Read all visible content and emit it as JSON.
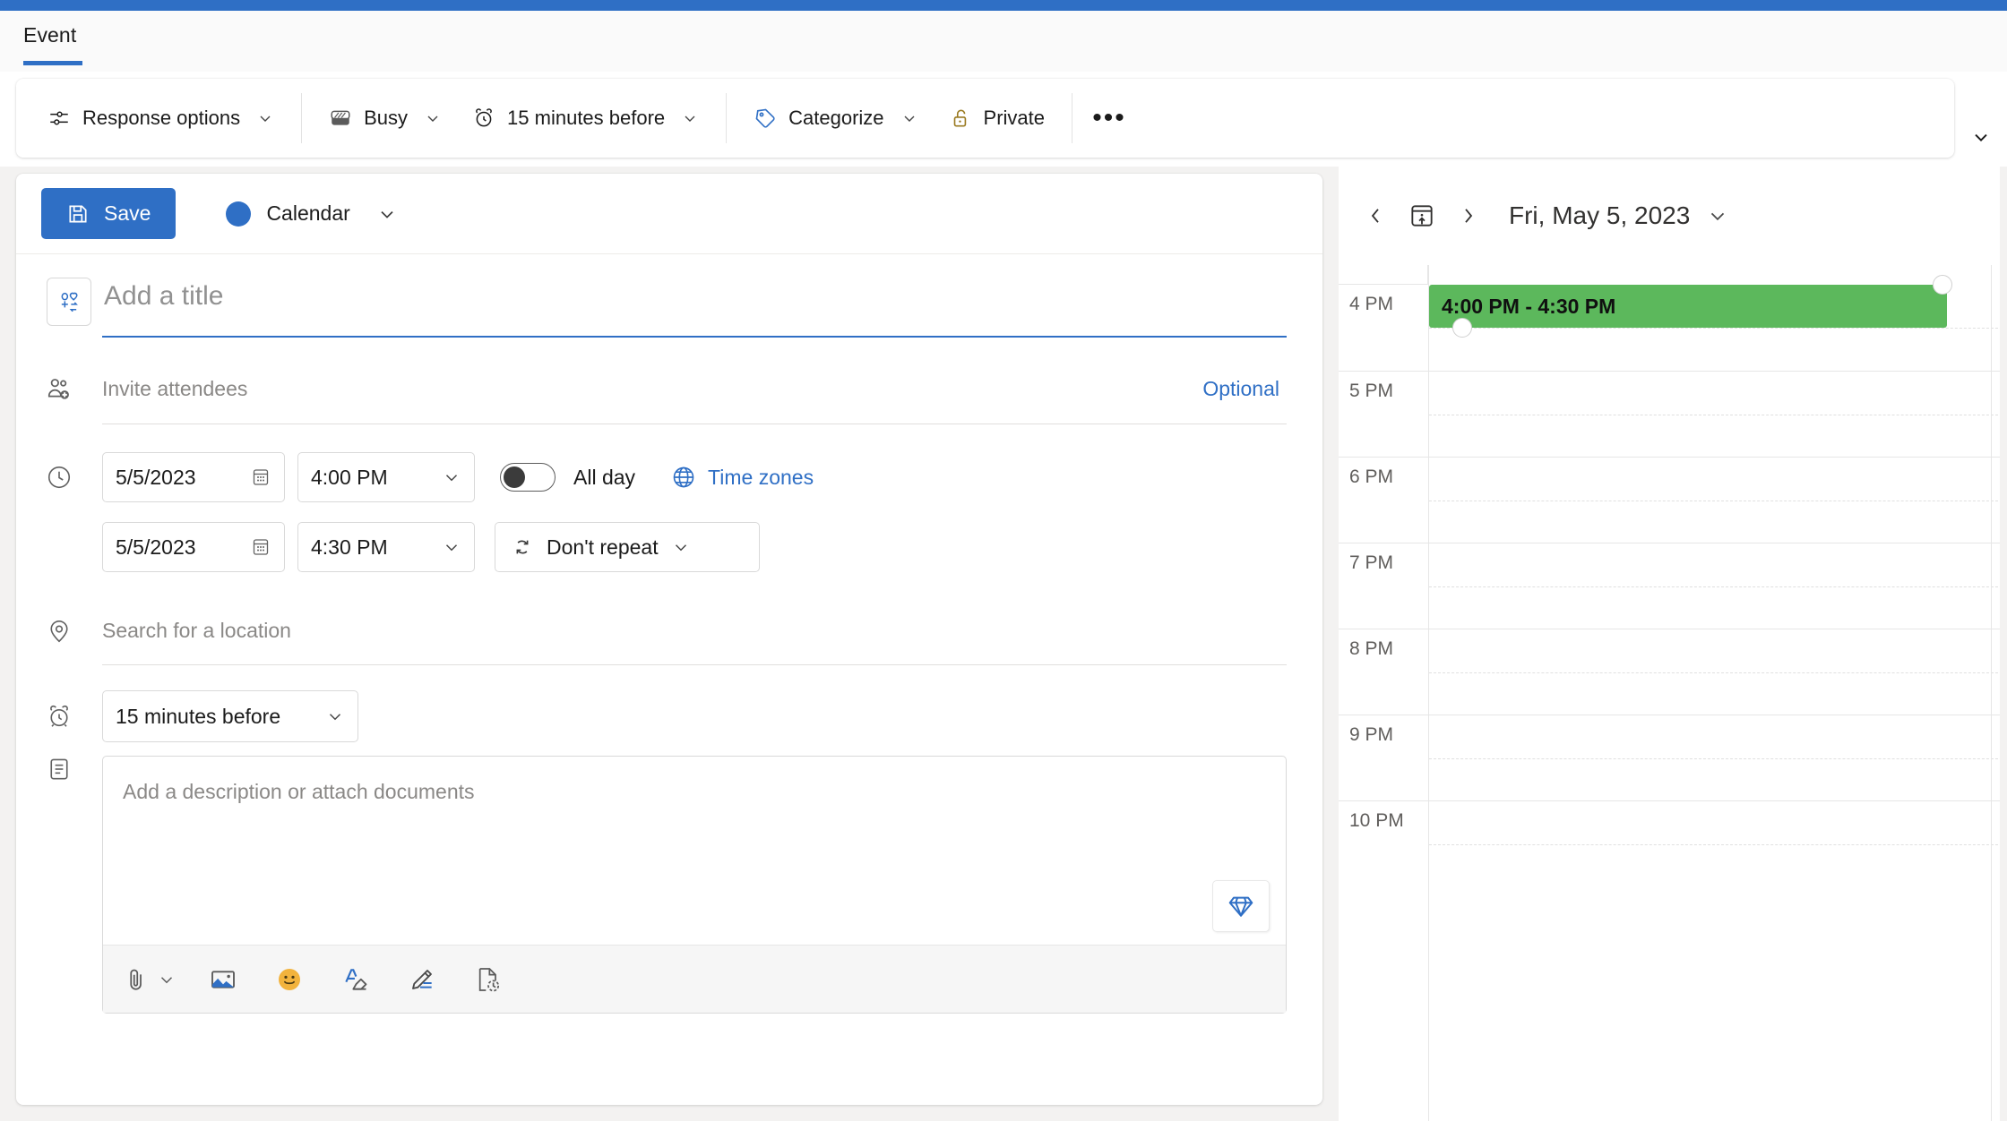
{
  "app": {
    "tab_label": "Event",
    "accent_color": "#2f6fc5",
    "event_color": "#5cb85c"
  },
  "ribbon": {
    "items": [
      {
        "id": "response-options",
        "label": "Response options",
        "icon": "response-options-icon",
        "has_chevron": true
      },
      {
        "id": "busy",
        "label": "Busy",
        "icon": "busy-icon",
        "has_chevron": true
      },
      {
        "id": "reminder",
        "label": "15 minutes before",
        "icon": "alarm-clock-icon",
        "has_chevron": true
      },
      {
        "id": "categorize",
        "label": "Categorize",
        "icon": "tag-icon",
        "has_chevron": true
      },
      {
        "id": "private",
        "label": "Private",
        "icon": "lock-icon",
        "has_chevron": false
      }
    ],
    "overflow_label": "•••",
    "expand_label": "⌄"
  },
  "form": {
    "save_label": "Save",
    "calendar_label": "Calendar",
    "calendar_dot_color": "#2f6fc5",
    "title": {
      "value": "",
      "placeholder": "Add a title"
    },
    "attendees": {
      "value": "",
      "placeholder": "Invite attendees"
    },
    "optional_label": "Optional",
    "start": {
      "date": "5/5/2023",
      "time": "4:00 PM"
    },
    "end": {
      "date": "5/5/2023",
      "time": "4:30 PM"
    },
    "all_day_label": "All day",
    "all_day_on": false,
    "time_zones_label": "Time zones",
    "repeat_label": "Don't repeat",
    "location": {
      "value": "",
      "placeholder": "Search for a location"
    },
    "reminder_label": "15 minutes before",
    "description": {
      "value": "",
      "placeholder": "Add a description or attach documents"
    },
    "editor_toolbar": [
      {
        "id": "attach",
        "icon": "paperclip-icon",
        "has_chevron": true
      },
      {
        "id": "insert-picture",
        "icon": "image-icon",
        "has_chevron": false
      },
      {
        "id": "emoji",
        "icon": "smiley-icon",
        "has_chevron": false
      },
      {
        "id": "clear-formatting",
        "icon": "clear-formatting-icon",
        "has_chevron": false
      },
      {
        "id": "draw",
        "icon": "pen-icon",
        "has_chevron": false
      },
      {
        "id": "insert-file",
        "icon": "document-clock-icon",
        "has_chevron": false
      }
    ],
    "loop_icon": "diamond-icon"
  },
  "calendar_panel": {
    "prev_label": "‹",
    "today_icon": "today-icon",
    "next_label": "›",
    "date_label": "Fri, May 5, 2023",
    "hours": [
      "4 PM",
      "5 PM",
      "6 PM",
      "7 PM",
      "8 PM",
      "9 PM",
      "10 PM"
    ],
    "event": {
      "time_range": "4:00 PM - 4:30 PM",
      "color": "#5cb85c"
    }
  }
}
